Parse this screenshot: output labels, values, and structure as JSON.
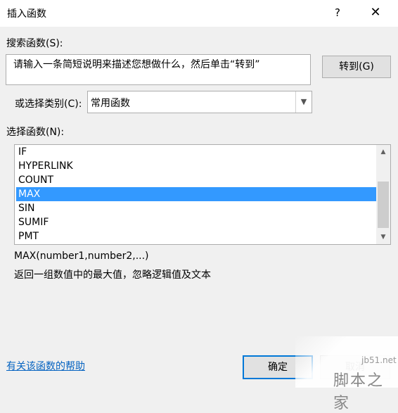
{
  "window": {
    "title": "插入函数",
    "help_glyph": "?",
    "close_glyph": "✕"
  },
  "search": {
    "label": "搜索函数(S):",
    "text": "请输入一条简短说明来描述您想做什么，然后单击“转到”",
    "goto_button": "转到(G)"
  },
  "category": {
    "label": "或选择类别(C):",
    "value": "常用函数"
  },
  "functions": {
    "label": "选择函数(N):",
    "items": [
      "IF",
      "HYPERLINK",
      "COUNT",
      "MAX",
      "SIN",
      "SUMIF",
      "PMT"
    ],
    "selected": "MAX"
  },
  "details": {
    "signature": "MAX(number1,number2,...)",
    "description": "返回一组数值中的最大值，忽略逻辑值及文本"
  },
  "footer": {
    "help_link": "有关该函数的帮助",
    "ok_button": "确定",
    "cancel_button": "取消"
  },
  "watermark": {
    "small": "jb51.net",
    "big": "脚本之家"
  }
}
